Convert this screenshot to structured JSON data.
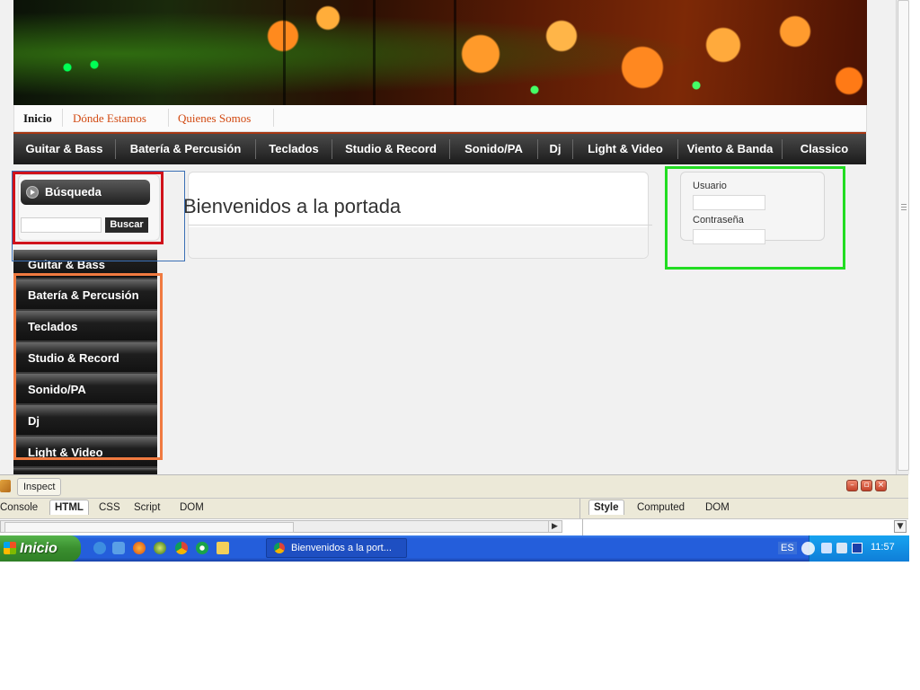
{
  "browser": {
    "top_links": [
      {
        "label": "Inicio"
      },
      {
        "label": "Dónde Estamos"
      },
      {
        "label": "Quienes Somos"
      }
    ],
    "main_nav": [
      {
        "label": "Guitar & Bass"
      },
      {
        "label": "Batería & Percusión"
      },
      {
        "label": "Teclados"
      },
      {
        "label": "Studio & Record"
      },
      {
        "label": "Sonido/PA"
      },
      {
        "label": "Dj"
      },
      {
        "label": "Light & Video"
      },
      {
        "label": "Viento & Banda"
      },
      {
        "label": "Classico"
      }
    ],
    "search": {
      "title": "Búsqueda",
      "input_value": "",
      "button": "Buscar"
    },
    "content": {
      "heading": "Bienvenidos a la portada"
    },
    "login": {
      "user_label": "Usuario",
      "password_label": "Contraseña"
    },
    "side_menu": [
      {
        "label": "Guitar & Bass"
      },
      {
        "label": "Batería & Percusión"
      },
      {
        "label": "Teclados"
      },
      {
        "label": "Studio & Record"
      },
      {
        "label": "Sonido/PA"
      },
      {
        "label": "Dj"
      },
      {
        "label": "Light & Video"
      }
    ]
  },
  "annotation_colors": {
    "search": "#d0121b",
    "side_menu": "#f07a40",
    "login": "#22dd22",
    "blue_box": "#3a6fb5"
  },
  "devtools": {
    "inspect_label": "Inspect",
    "left_tabs": [
      "Console",
      "HTML",
      "CSS",
      "Script",
      "DOM"
    ],
    "right_tabs": [
      "Style",
      "Computed",
      "DOM"
    ],
    "selected_left": "HTML",
    "selected_right": "Style"
  },
  "taskbar": {
    "start_label": "Inicio",
    "task_label": "Bienvenidos a la port...",
    "language": "ES",
    "clock": "11:57"
  }
}
